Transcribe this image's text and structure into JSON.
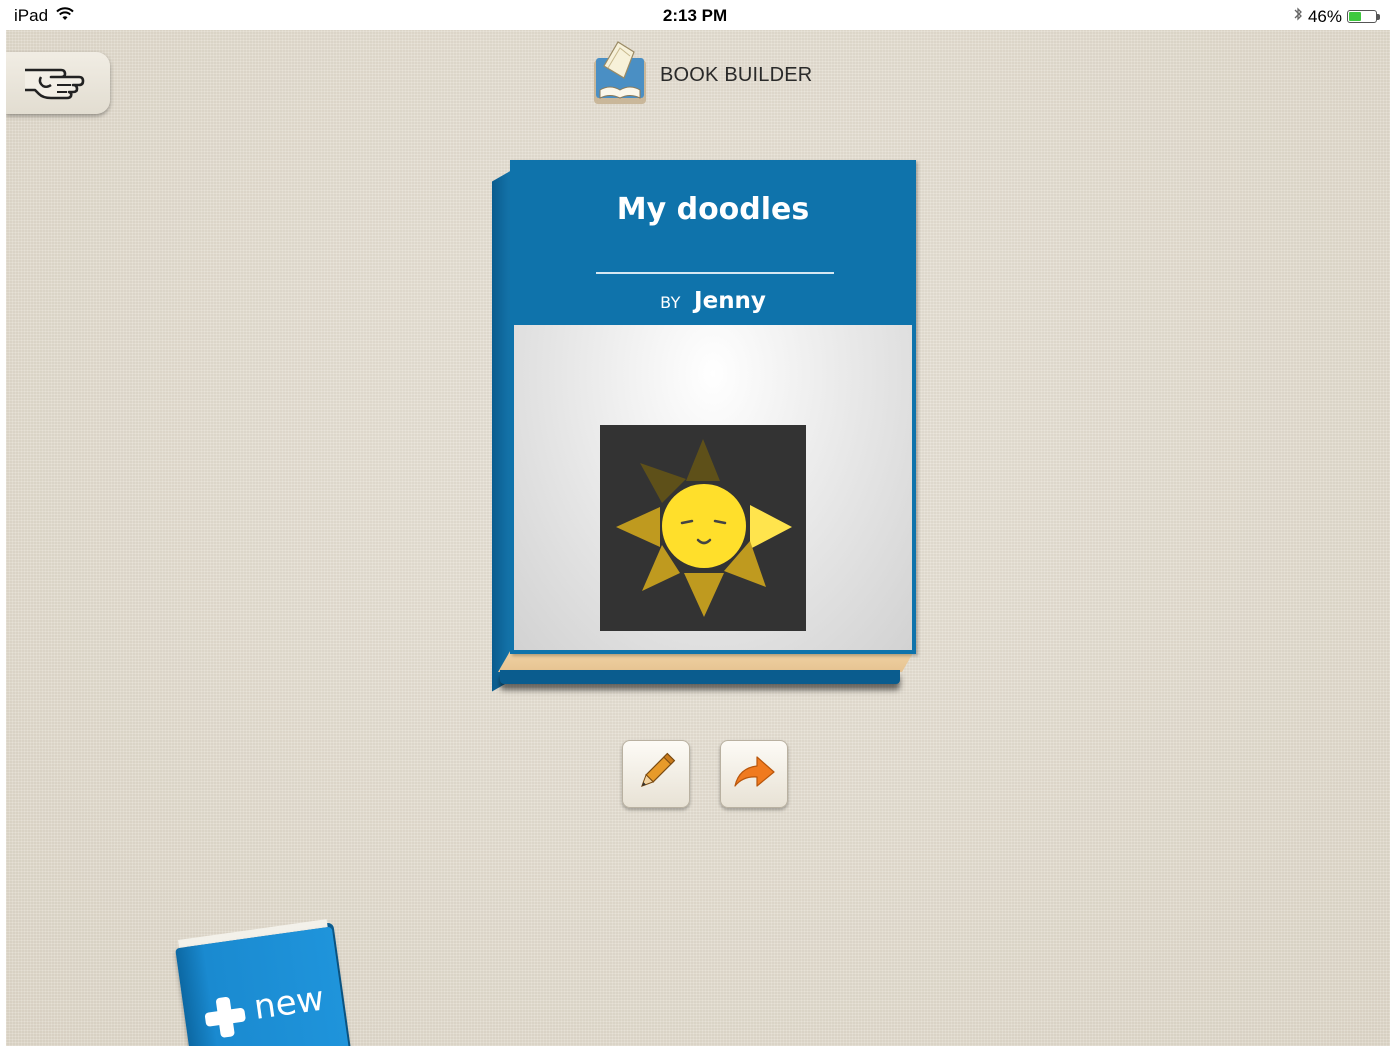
{
  "status_bar": {
    "device": "iPad",
    "time": "2:13 PM",
    "battery": "46%",
    "battery_level": 0.46,
    "icons": [
      "wifi-icon",
      "bluetooth-icon",
      "battery-icon"
    ]
  },
  "header": {
    "app_title": "BOOK BUILDER",
    "icon": "book-builder-logo-icon"
  },
  "help_button": {
    "icon": "pointing-hand-icon"
  },
  "book": {
    "title": "My doodles",
    "by_label": "BY",
    "author": "Jenny",
    "cover_color": "#0f73ab",
    "cover_image": "sun-doodle"
  },
  "actions": {
    "edit_icon": "pencil-icon",
    "share_icon": "share-arrow-icon"
  },
  "new_book": {
    "label": "new",
    "icon": "plus-icon"
  }
}
